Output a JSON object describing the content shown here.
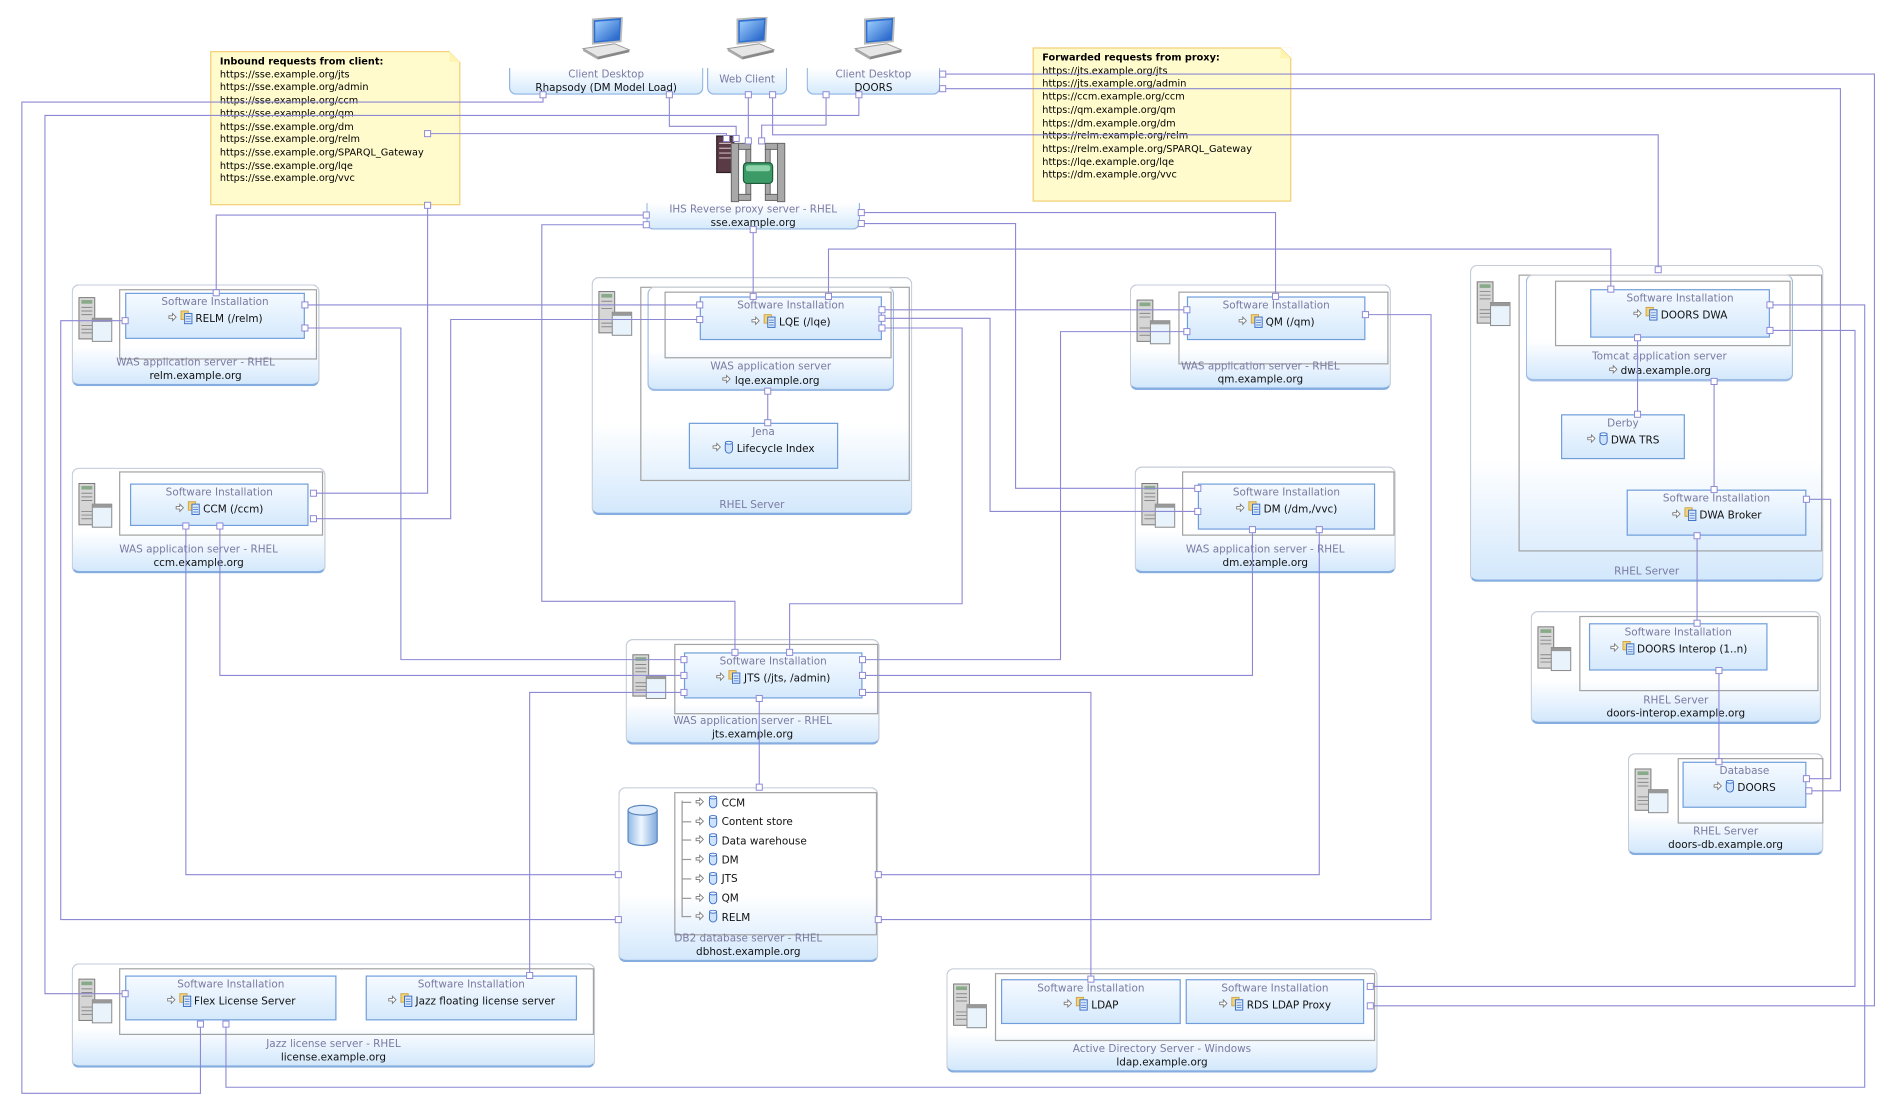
{
  "notes": {
    "inbound": {
      "title": "Inbound requests from client:",
      "lines": [
        "https://sse.example.org/jts",
        "https://sse.example.org/admin",
        "https://sse.example.org/ccm",
        "https://sse.example.org/qm",
        "https://sse.example.org/dm",
        "https://sse.example.org/relm",
        "https://sse.example.org/SPARQL_Gateway",
        "https://sse.example.org/lqe",
        "https://sse.example.org/vvc"
      ]
    },
    "forwarded": {
      "title": "Forwarded requests from proxy:",
      "lines": [
        "https://jts.example.org/jts",
        "https://jts.example.org/admin",
        "https://ccm.example.org/ccm",
        "https://qm.example.org/qm",
        "https://dm.example.org/dm",
        "https://relm.example.org/relm",
        "https://relm.example.org/SPARQL_Gateway",
        "https://lqe.example.org/lqe",
        "https://dm.example.org/vvc"
      ]
    }
  },
  "clients": [
    {
      "title": "Client Desktop",
      "subtitle": "Rhapsody (DM Model Load)",
      "icon": "laptop-icon"
    },
    {
      "title": "Web Client",
      "icon": "laptop-icon"
    },
    {
      "title": "Client Desktop",
      "subtitle": "DOORS",
      "icon": "laptop-icon"
    }
  ],
  "proxy": {
    "label": "IHS Reverse proxy server -  RHEL",
    "host": "sse.example.org",
    "icon": "proxy-server-icon"
  },
  "nodes": {
    "relm": {
      "label": "WAS application server - RHEL",
      "host": "relm.example.org",
      "components": [
        {
          "title": "Software Installation",
          "name": "RELM (/relm)",
          "icon": "artifact-icon"
        }
      ]
    },
    "lqe": {
      "label": "RHEL Server",
      "server": {
        "label": "WAS application server",
        "host": "lqe.example.org",
        "components": [
          {
            "title": "Software Installation",
            "name": "LQE (/lqe)",
            "icon": "artifact-icon"
          }
        ]
      },
      "components": [
        {
          "title": "Jena",
          "name": "Lifecycle Index",
          "icon": "database-icon"
        }
      ]
    },
    "qm": {
      "label": "WAS application server -  RHEL",
      "host": "qm.example.org",
      "components": [
        {
          "title": "Software Installation",
          "name": "QM (/qm)",
          "icon": "artifact-icon"
        }
      ]
    },
    "dwa": {
      "label": "RHEL Server",
      "server": {
        "label": "Tomcat application server",
        "host": "dwa.example.org",
        "components": [
          {
            "title": "Software Installation",
            "name": "DOORS DWA",
            "icon": "artifact-icon"
          }
        ]
      },
      "components": [
        {
          "title": "Derby",
          "name": "DWA TRS",
          "icon": "database-icon"
        },
        {
          "title": "Software Installation",
          "name": "DWA Broker",
          "icon": "artifact-icon"
        }
      ]
    },
    "ccm": {
      "label": "WAS application server -  RHEL",
      "host": "ccm.example.org",
      "components": [
        {
          "title": "Software Installation",
          "name": "CCM (/ccm)",
          "icon": "artifact-icon"
        }
      ]
    },
    "dm": {
      "label": "WAS application server - RHEL",
      "host": "dm.example.org",
      "components": [
        {
          "title": "Software Installation",
          "name": "DM (/dm,/vvc)",
          "icon": "artifact-icon"
        }
      ]
    },
    "jts": {
      "label": "WAS application server -  RHEL",
      "host": "jts.example.org",
      "components": [
        {
          "title": "Software Installation",
          "name": "JTS (/jts, /admin)",
          "icon": "artifact-icon"
        }
      ]
    },
    "db2": {
      "label": "DB2 database server - RHEL",
      "host": "dbhost.example.org",
      "databases": [
        "CCM",
        "Content store",
        "Data warehouse",
        "DM",
        "JTS",
        "QM",
        "RELM"
      ]
    },
    "interop": {
      "label": "RHEL Server",
      "host": "doors-interop.example.org",
      "components": [
        {
          "title": "Software Installation",
          "name": "DOORS Interop (1..n)",
          "icon": "artifact-icon"
        }
      ]
    },
    "doorsdb": {
      "label": "RHEL Server",
      "host": "doors-db.example.org",
      "components": [
        {
          "title": "Database",
          "name": "DOORS",
          "icon": "database-icon"
        }
      ]
    },
    "license": {
      "label": "Jazz license server -  RHEL",
      "host": "license.example.org",
      "components": [
        {
          "title": "Software Installation",
          "name": "Flex License Server",
          "icon": "artifact-icon"
        },
        {
          "title": "Software Installation",
          "name": "Jazz floating license server",
          "icon": "artifact-icon"
        }
      ]
    },
    "ad": {
      "label": "Active Directory Server - Windows",
      "host": "ldap.example.org",
      "components": [
        {
          "title": "Software Installation",
          "name": "LDAP",
          "icon": "artifact-icon"
        },
        {
          "title": "Software Installation",
          "name": "RDS LDAP Proxy",
          "icon": "artifact-icon"
        }
      ]
    }
  },
  "colors": {
    "connector": "#8c88d4",
    "component_border": "#6f9edb",
    "note_fill": "#fffbcc",
    "note_border": "#f3cf78",
    "label_text": "#7a7aa2"
  }
}
